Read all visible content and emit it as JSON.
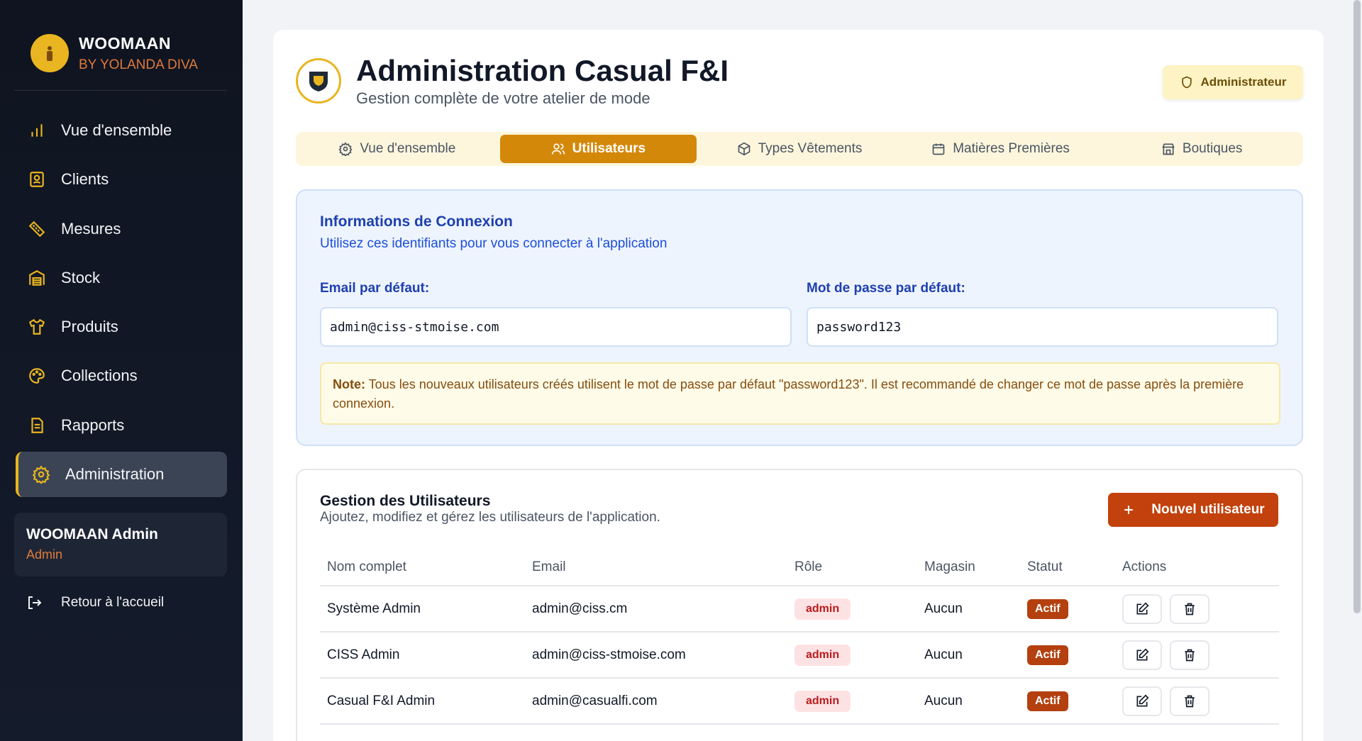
{
  "sidebar": {
    "brand_name": "WOOMAAN",
    "brand_sub": "BY YOLANDA DIVA",
    "items": [
      {
        "label": "Vue d'ensemble",
        "icon": "bar-chart-icon"
      },
      {
        "label": "Clients",
        "icon": "contact-book-icon"
      },
      {
        "label": "Mesures",
        "icon": "ruler-icon"
      },
      {
        "label": "Stock",
        "icon": "warehouse-icon"
      },
      {
        "label": "Produits",
        "icon": "shirt-icon"
      },
      {
        "label": "Collections",
        "icon": "palette-icon"
      },
      {
        "label": "Rapports",
        "icon": "document-icon"
      },
      {
        "label": "Administration",
        "icon": "gear-icon"
      }
    ],
    "active_item": "Administration",
    "user": {
      "name": "WOOMAAN Admin",
      "role": "Admin"
    },
    "back_label": "Retour à l'accueil"
  },
  "header": {
    "title": "Administration Casual F&I",
    "subtitle": "Gestion complète de votre atelier de mode",
    "role_badge": "Administrateur"
  },
  "tabs": [
    {
      "label": "Vue d'ensemble",
      "icon": "gear-icon"
    },
    {
      "label": "Utilisateurs",
      "icon": "users-icon"
    },
    {
      "label": "Types Vêtements",
      "icon": "package-icon"
    },
    {
      "label": "Matières Premières",
      "icon": "calendar-box-icon"
    },
    {
      "label": "Boutiques",
      "icon": "store-icon"
    }
  ],
  "active_tab": "Utilisateurs",
  "login_info": {
    "title": "Informations de Connexion",
    "subtitle": "Utilisez ces identifiants pour vous connecter à l'application",
    "email_label": "Email par défaut:",
    "email_value": "admin@ciss-stmoise.com",
    "password_label": "Mot de passe par défaut:",
    "password_value": "password123",
    "note_prefix": "Note:",
    "note_text": " Tous les nouveaux utilisateurs créés utilisent le mot de passe par défaut \"password123\". Il est recommandé de changer ce mot de passe après la première connexion."
  },
  "users": {
    "title": "Gestion des Utilisateurs",
    "subtitle": "Ajoutez, modifiez et gérez les utilisateurs de l'application.",
    "new_button": "Nouvel utilisateur",
    "columns": [
      "Nom complet",
      "Email",
      "Rôle",
      "Magasin",
      "Statut",
      "Actions"
    ],
    "rows": [
      {
        "name": "Système Admin",
        "email": "admin@ciss.cm",
        "role": "admin",
        "store": "Aucun",
        "status": "Actif"
      },
      {
        "name": "CISS Admin",
        "email": "admin@ciss-stmoise.com",
        "role": "admin",
        "store": "Aucun",
        "status": "Actif"
      },
      {
        "name": "Casual F&I Admin",
        "email": "admin@casualfi.com",
        "role": "admin",
        "store": "Aucun",
        "status": "Actif"
      }
    ]
  },
  "colors": {
    "accent": "#e9b520",
    "tab_active": "#d4880a",
    "primary_button": "#c2410c",
    "sidebar_bg": "#0f1420"
  }
}
